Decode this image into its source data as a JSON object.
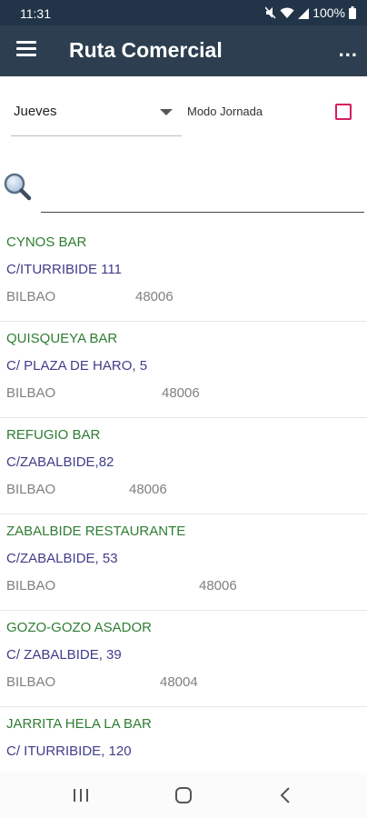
{
  "status_bar": {
    "time": "11:31",
    "battery": "100%",
    "icons": [
      "mute-icon",
      "wifi-icon",
      "signal-icon",
      "battery-icon"
    ]
  },
  "app_bar": {
    "title": "Ruta Comercial",
    "overflow_label": "...",
    "menu_icon": "hamburger-menu-icon"
  },
  "filters": {
    "day_selected": "Jueves",
    "mode_label": "Modo Jornada",
    "mode_checked": false
  },
  "search": {
    "placeholder": "",
    "value": ""
  },
  "clients": [
    {
      "name": "CYNOS BAR",
      "address": "C/ITURRIBIDE 111",
      "city": "BILBAO",
      "zip": "48006"
    },
    {
      "name": "QUISQUEYA BAR",
      "address": "C/ PLAZA DE HARO, 5",
      "city": "BILBAO",
      "zip": "48006"
    },
    {
      "name": "REFUGIO BAR",
      "address": "C/ZABALBIDE,82",
      "city": "BILBAO",
      "zip": "48006"
    },
    {
      "name": "ZABALBIDE RESTAURANTE",
      "address": "C/ZABALBIDE, 53",
      "city": "BILBAO",
      "zip": "48006"
    },
    {
      "name": "GOZO-GOZO ASADOR",
      "address": "C/ ZABALBIDE, 39",
      "city": "BILBAO",
      "zip": "48004"
    },
    {
      "name": "JARRITA HELA LA BAR",
      "address": "C/ ITURRIBIDE, 120",
      "city": "",
      "zip": ""
    }
  ],
  "colors": {
    "status_bar": "#223447",
    "app_bar": "#2c3e4f",
    "client_name": "#2e7d32",
    "client_address": "#3f3d8a",
    "client_meta": "#808080",
    "checkbox_accent": "#d81b60"
  },
  "nav_bar": {
    "buttons": [
      "recent-apps-icon",
      "home-icon",
      "back-icon"
    ]
  }
}
